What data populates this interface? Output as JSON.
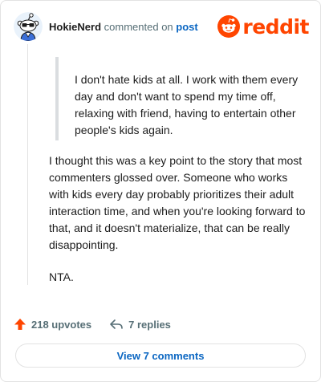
{
  "comment": {
    "username": "HokieNerd",
    "action_text": "commented on",
    "post_link": "post",
    "quote_text": "I don't hate kids at all. I work with them every day and don't want to spend my time off, relaxing with friend, having to entertain other people's kids again.",
    "paragraphs": [
      "I thought this was a key point to the story that most commenters glossed over. Someone who works with kids every day probably prioritizes their adult interaction time, and when you're looking forward to that, and it doesn't materialize, that can be really disappointing.",
      "NTA."
    ]
  },
  "brand": {
    "logo_text": "reddit",
    "color": "#ff4500"
  },
  "stats": {
    "upvotes": "218 upvotes",
    "replies": "7 replies",
    "upvote_icon": "upvote-arrow-icon",
    "reply_icon": "reply-arrow-icon"
  },
  "actions": {
    "view_comments": "View 7 comments"
  }
}
